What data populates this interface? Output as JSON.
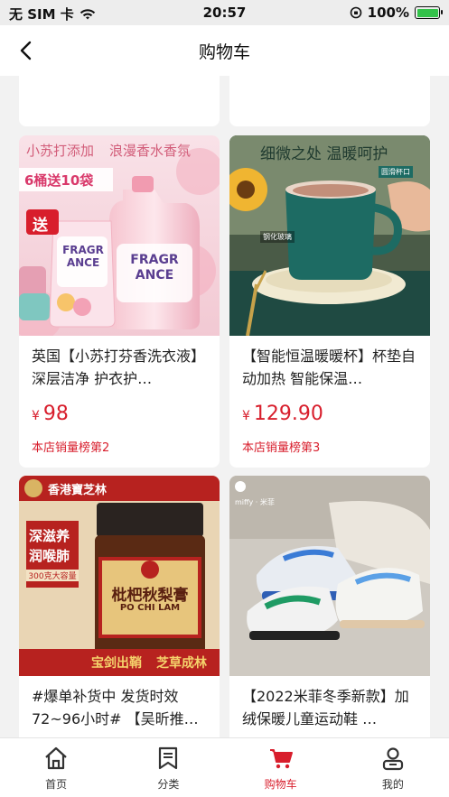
{
  "status_bar": {
    "carrier": "无 SIM 卡",
    "time": "20:57",
    "battery": "100%"
  },
  "nav": {
    "title": "购物车"
  },
  "products": [
    {
      "title": "英国【小苏打芬香洗衣液】 深层洁净 护衣护…",
      "price": "98",
      "currency": "¥",
      "rank": "本店销量榜第2",
      "image": {
        "banner_left": "小苏打添加",
        "banner_right": "浪漫香水香氛",
        "promo": "6桶送10袋",
        "gift_tag": "送",
        "bottle_text": "FRAGR ANCE",
        "pouch_text": "FRAGR ANCE"
      }
    },
    {
      "title": "【智能恒温暖暖杯】杯垫自动加热 智能保温…",
      "price": "129.90",
      "currency": "¥",
      "rank": "本店销量榜第3",
      "image": {
        "headline": "细微之处 温暖呵护",
        "tag_top": "圆滑杯口",
        "tag_side": "钢化玻璃"
      }
    },
    {
      "title": "#爆单补货中 发货时效72~96小时# 【吴昕推…",
      "image": {
        "brand": "香港寶芝林",
        "side_text_1": "深滋养",
        "side_text_2": "润喉肺",
        "capacity": "300克大容量",
        "jar_label": "枇杷秋梨膏",
        "jar_brand": "PO CHI LAM",
        "bottom_left": "宝剑出鞘",
        "bottom_right": "芝草成林"
      }
    },
    {
      "title": "【2022米菲冬季新款】加绒保暖儿童运动鞋 …",
      "image": {
        "brand": "miffy · 米菲"
      }
    }
  ],
  "tabs": [
    {
      "label": "首页",
      "icon": "home-icon"
    },
    {
      "label": "分类",
      "icon": "category-icon"
    },
    {
      "label": "购物车",
      "icon": "cart-icon",
      "active": true
    },
    {
      "label": "我的",
      "icon": "profile-icon"
    }
  ],
  "colors": {
    "accent": "#d81e2c",
    "background": "#f2f2f2"
  }
}
